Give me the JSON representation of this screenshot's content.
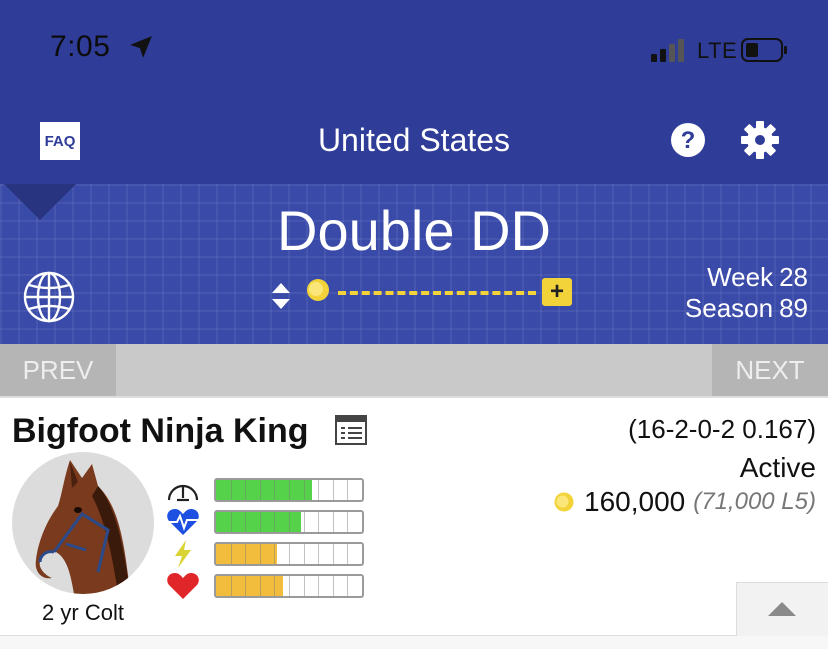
{
  "status_bar": {
    "time": "7:05",
    "network": "LTE"
  },
  "nav": {
    "faq_label": "FAQ",
    "title": "United States"
  },
  "stable": {
    "name": "Double DD",
    "week_label": "Week",
    "week_value": "28",
    "season_label": "Season",
    "season_value": "89",
    "plus_label": "+"
  },
  "pager": {
    "prev_label": "PREV",
    "next_label": "NEXT"
  },
  "horse": {
    "name": "Bigfoot Ninja King",
    "record": "(16-2-0-2 0.167)",
    "status": "Active",
    "earnings": "160,000",
    "earnings_l5": "(71,000 L5)",
    "age_sex": "2 yr Colt",
    "stats": [
      {
        "icon": "speedometer-icon",
        "level": 0.66,
        "color": "#55d24a"
      },
      {
        "icon": "heartbeat-icon",
        "level": 0.58,
        "color": "#55d24a"
      },
      {
        "icon": "lightning-icon",
        "level": 0.42,
        "color": "#f2bd3c"
      },
      {
        "icon": "heart-icon",
        "level": 0.46,
        "color": "#f2bd3c"
      }
    ]
  },
  "colors": {
    "brand": "#2f3c98",
    "coin": "#f3d33a"
  }
}
